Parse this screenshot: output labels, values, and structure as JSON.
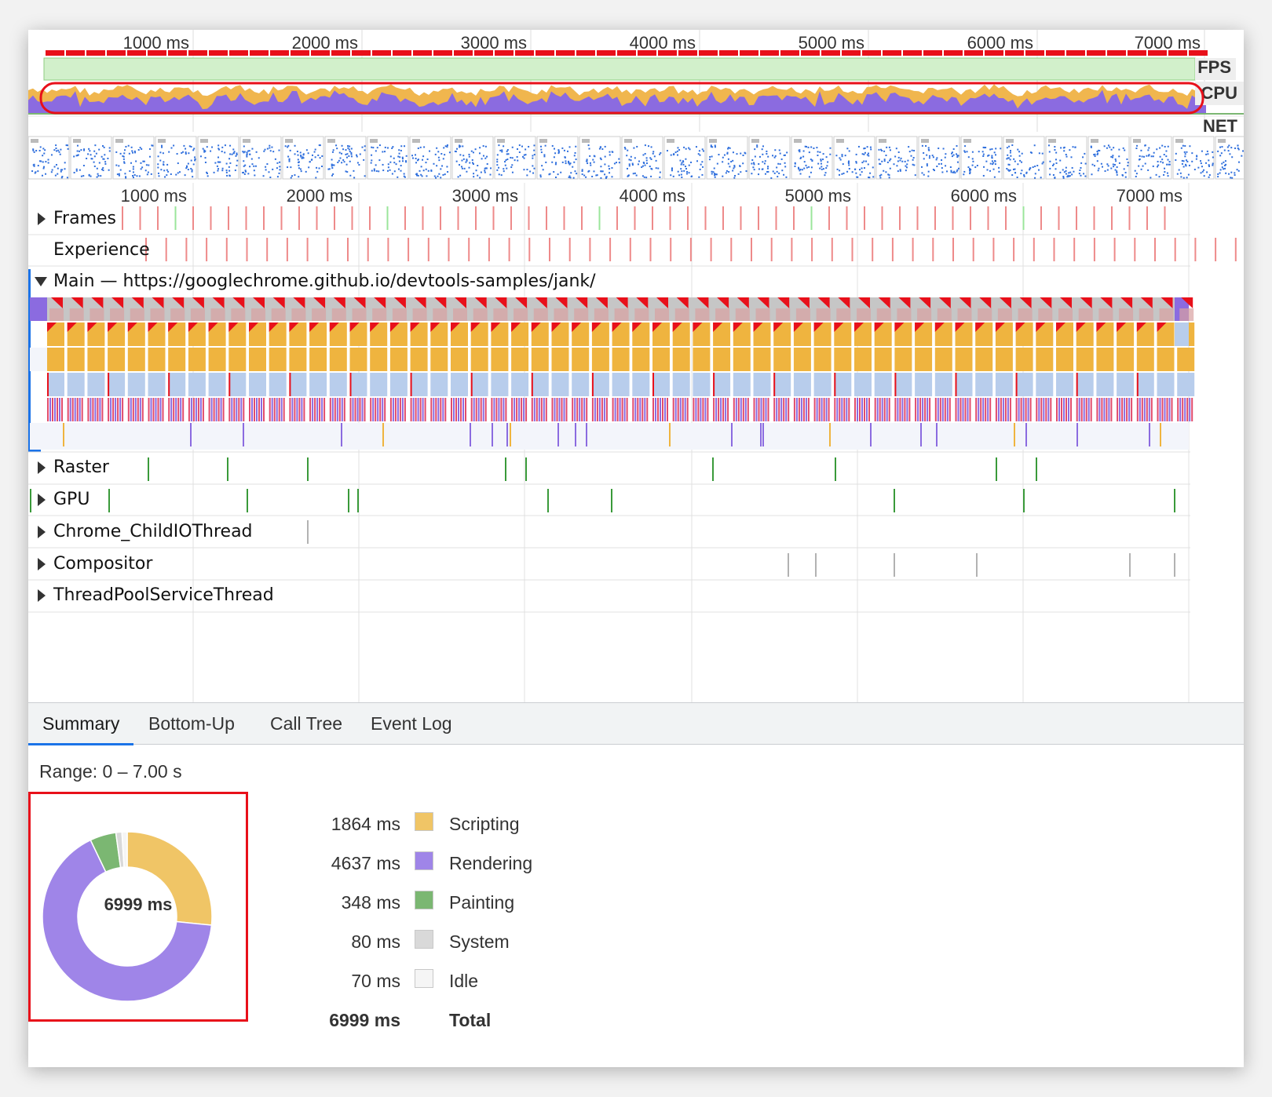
{
  "overview": {
    "ticks": [
      "1000 ms",
      "2000 ms",
      "3000 ms",
      "4000 ms",
      "5000 ms",
      "6000 ms",
      "7000 ms"
    ],
    "fps_label": "FPS",
    "cpu_label": "CPU",
    "net_label": "NET"
  },
  "timeline": {
    "ticks": [
      "1000 ms",
      "2000 ms",
      "3000 ms",
      "4000 ms",
      "5000 ms",
      "6000 ms",
      "7000 ms"
    ],
    "tracks": {
      "frames": "Frames",
      "experience": "Experience",
      "main": "Main — https://googlechrome.github.io/devtools-samples/jank/",
      "raster": "Raster",
      "gpu": "GPU",
      "childio": "Chrome_ChildIOThread",
      "compositor": "Compositor",
      "threadpool": "ThreadPoolServiceThread"
    }
  },
  "tabs": [
    "Summary",
    "Bottom-Up",
    "Call Tree",
    "Event Log"
  ],
  "summary": {
    "range": "Range: 0 – 7.00 s",
    "total_center": "6999 ms",
    "items": [
      {
        "value": "1864 ms",
        "label": "Scripting",
        "color": "#f0c566"
      },
      {
        "value": "4637 ms",
        "label": "Rendering",
        "color": "#9f85e8"
      },
      {
        "value": "348 ms",
        "label": "Painting",
        "color": "#7bb772"
      },
      {
        "value": "80 ms",
        "label": "System",
        "color": "#d9d9d9"
      },
      {
        "value": "70 ms",
        "label": "Idle",
        "color": "#f5f5f5"
      }
    ],
    "total": {
      "value": "6999 ms",
      "label": "Total"
    }
  },
  "colors": {
    "fps_bar": "#e8101a",
    "fps_fill": "#d2f0cb",
    "cpu_rendering": "#8b6be0",
    "cpu_scripting": "#f0b64e",
    "highlight": "#e8101a",
    "accent": "#1a73e8"
  }
}
